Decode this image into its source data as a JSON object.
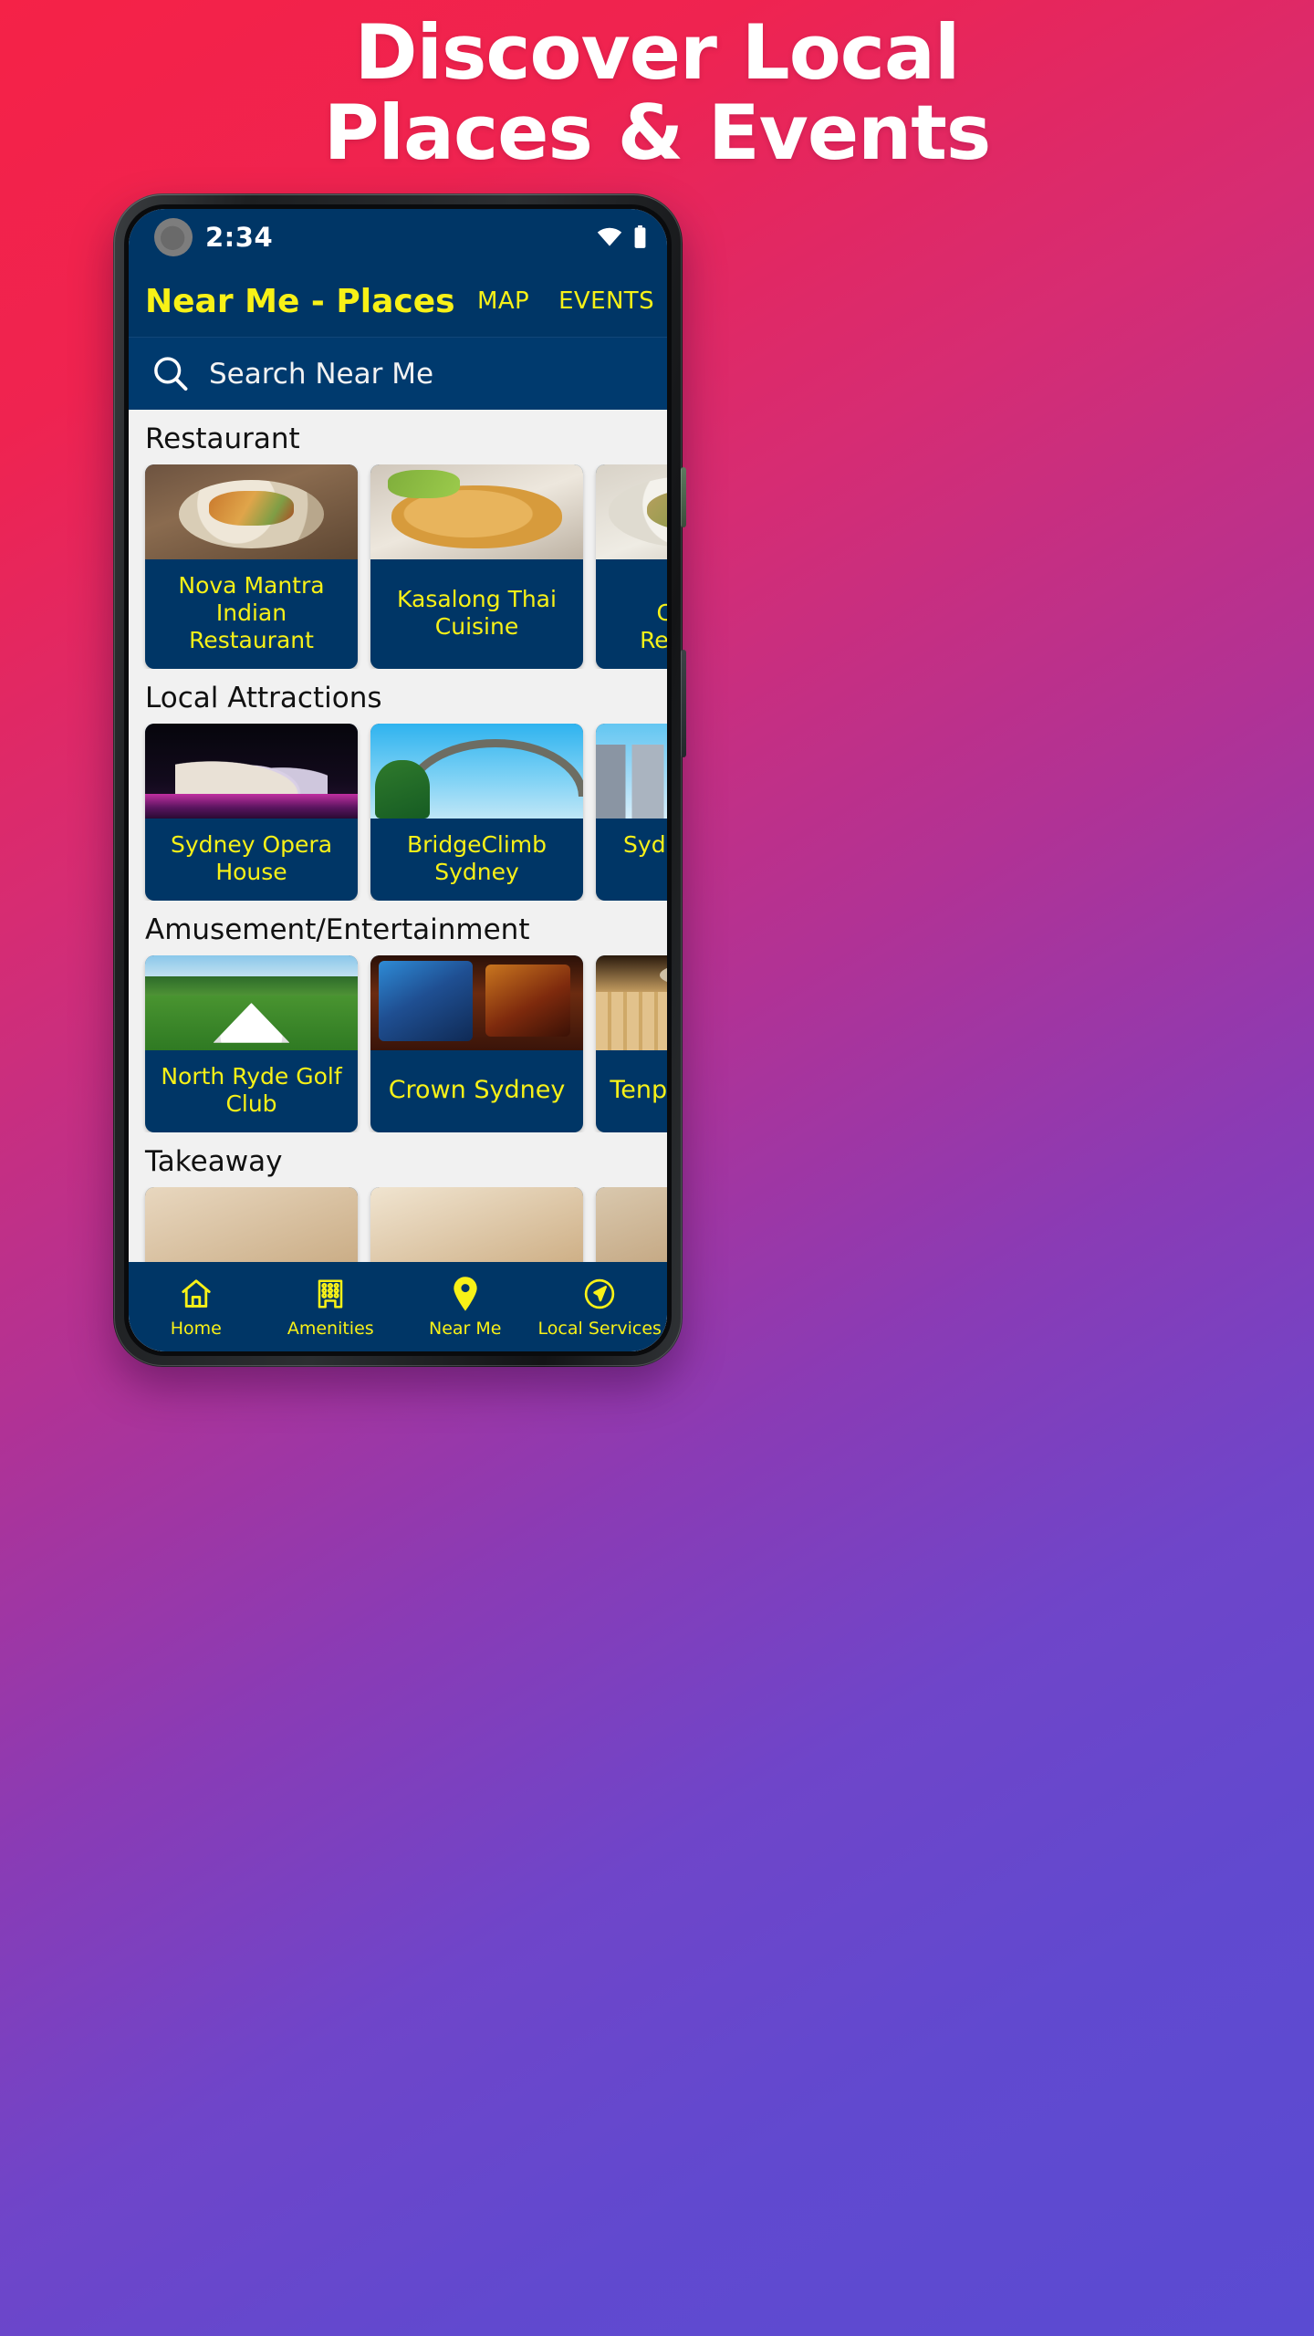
{
  "poster": {
    "headline_line1": "Discover Local",
    "headline_line2": "Places & Events",
    "background_start": "#f52247",
    "background_end": "#5a4bd2"
  },
  "phone": {
    "statusbar": {
      "time": "2:34",
      "wifi_icon": "wifi-icon",
      "battery_icon": "battery-icon",
      "camera_icon": "front-camera-punchhole"
    },
    "appbar": {
      "title": "Near Me - Places",
      "actions": [
        {
          "label": "MAP",
          "name": "map-action"
        },
        {
          "label": "EVENTS",
          "name": "events-action"
        }
      ],
      "background": "#003666",
      "text_color": "#f8f117"
    },
    "search": {
      "placeholder": "Search Near Me",
      "value": "",
      "icon": "search-icon"
    },
    "sections": [
      {
        "title": "Restaurant",
        "cards": [
          {
            "label": "Nova Mantra\nIndian Restaurant",
            "image": "indian-thali-photo"
          },
          {
            "label": "Kasalong Thai\nCuisine",
            "image": "thai-noodles-photo"
          },
          {
            "label": "Noble\nChinese Restaurant",
            "image": "chinese-dish-photo"
          }
        ]
      },
      {
        "title": "Local Attractions",
        "cards": [
          {
            "label": "Sydney Opera\nHouse",
            "image": "sydney-opera-house-photo"
          },
          {
            "label": "BridgeClimb\nSydney",
            "image": "harbour-bridge-photo"
          },
          {
            "label": "Sydney Tower Eye",
            "image": "sydney-skyline-photo"
          }
        ]
      },
      {
        "title": "Amusement/Entertainment",
        "cards": [
          {
            "label": "North Ryde Golf\nClub",
            "image": "golf-course-photo"
          },
          {
            "label": "Crown Sydney",
            "image": "casino-interior-photo"
          },
          {
            "label": "Tenpin Bowling",
            "image": "bowling-alley-photo"
          }
        ]
      },
      {
        "title": "Takeaway",
        "cards": [
          {
            "label": "",
            "image": "takeaway-photo-1"
          },
          {
            "label": "",
            "image": "takeaway-photo-2"
          },
          {
            "label": "",
            "image": "takeaway-photo-3"
          }
        ]
      }
    ],
    "bottom_nav": {
      "items": [
        {
          "label": "Home",
          "icon": "home-icon",
          "active": false
        },
        {
          "label": "Amenities",
          "icon": "building-icon",
          "active": false
        },
        {
          "label": "Near Me",
          "icon": "location-pin-icon",
          "active": true
        },
        {
          "label": "Local Services",
          "icon": "navigation-arrow-icon",
          "active": false
        }
      ],
      "background": "#003666",
      "icon_color": "#f8f117"
    }
  }
}
